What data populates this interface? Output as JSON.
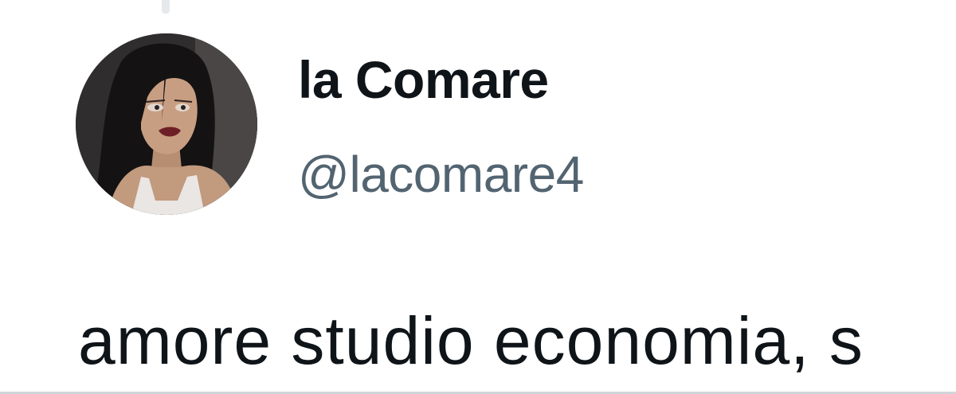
{
  "tweet": {
    "author": {
      "display_name": "la Comare",
      "handle": "@lacomare4",
      "avatar_icon": "cartoon-woman-avatar"
    },
    "text": "amore studio economia, s"
  },
  "colors": {
    "background": "#ffffff",
    "text_primary": "#0f1419",
    "text_secondary": "#536471"
  }
}
